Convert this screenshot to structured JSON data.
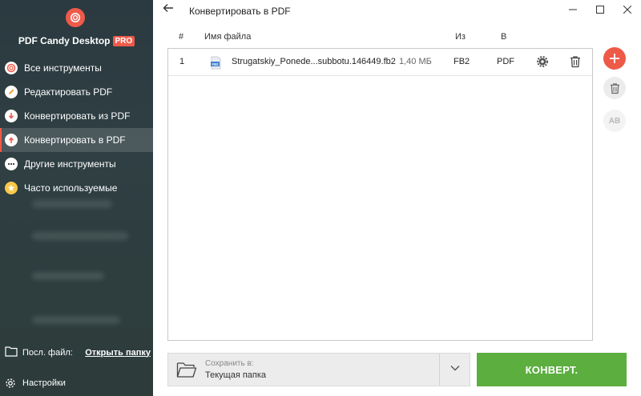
{
  "app": {
    "brand_name": "PDF Candy Desktop",
    "brand_badge": "PRO",
    "accent_color": "#ef5a4a",
    "convert_color": "#5cae3f"
  },
  "sidebar": {
    "items": [
      {
        "label": "Все инструменты",
        "icon": "target-icon",
        "active": false
      },
      {
        "label": "Редактировать PDF",
        "icon": "edit-icon",
        "active": false
      },
      {
        "label": "Конвертировать из PDF",
        "icon": "arrow-down-icon",
        "active": false
      },
      {
        "label": "Конвертировать в PDF",
        "icon": "arrow-up-icon",
        "active": true
      },
      {
        "label": "Другие инструменты",
        "icon": "more-icon",
        "active": false
      },
      {
        "label": "Часто используемые",
        "icon": "star-icon",
        "active": false
      }
    ],
    "last_file_label": "Посл. файл:",
    "open_folder_link": "Открыть папку",
    "settings_label": "Настройки"
  },
  "header": {
    "title": "Конвертировать в PDF"
  },
  "table": {
    "columns": {
      "num": "#",
      "name": "Имя файла",
      "from": "Из",
      "to": "В"
    },
    "rows": [
      {
        "num": "1",
        "name": "Strugatskiy_Ponede...subbotu.146449.fb2",
        "size": "1,40 МБ",
        "from": "FB2",
        "to": "PDF",
        "file_type": "FB2"
      }
    ]
  },
  "side_actions": {
    "rename_label": "AB"
  },
  "save": {
    "label": "Сохранить в:",
    "value": "Текущая папка"
  },
  "convert_button": "КОНВЕРТ."
}
